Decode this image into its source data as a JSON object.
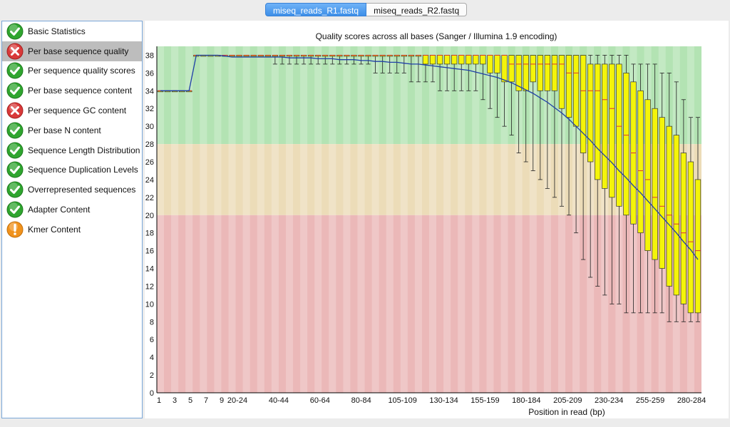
{
  "tabs": [
    {
      "label": "miseq_reads_R1.fastq",
      "active": true
    },
    {
      "label": "miseq_reads_R2.fastq",
      "active": false
    }
  ],
  "modules": [
    {
      "label": "Basic Statistics",
      "status": "pass",
      "icon": "check-icon"
    },
    {
      "label": "Per base sequence quality",
      "status": "fail",
      "icon": "cross-icon",
      "selected": true
    },
    {
      "label": "Per sequence quality scores",
      "status": "pass",
      "icon": "check-icon"
    },
    {
      "label": "Per base sequence content",
      "status": "pass",
      "icon": "check-icon"
    },
    {
      "label": "Per sequence GC content",
      "status": "fail",
      "icon": "cross-icon"
    },
    {
      "label": "Per base N content",
      "status": "pass",
      "icon": "check-icon"
    },
    {
      "label": "Sequence Length Distribution",
      "status": "pass",
      "icon": "check-icon"
    },
    {
      "label": "Sequence Duplication Levels",
      "status": "pass",
      "icon": "check-icon"
    },
    {
      "label": "Overrepresented sequences",
      "status": "pass",
      "icon": "check-icon"
    },
    {
      "label": "Adapter Content",
      "status": "pass",
      "icon": "check-icon"
    },
    {
      "label": "Kmer Content",
      "status": "warn",
      "icon": "warning-icon"
    }
  ],
  "colors": {
    "pass": "#2fa52f",
    "fail": "#d93a3a",
    "warn": "#f0921c",
    "zone_good": "#b3e3b3",
    "zone_ok": "#ecdcb8",
    "zone_bad": "#ebb8b8",
    "box_fill": "#f4f40a",
    "mean_line": "#1f3fa8",
    "median": "#d33"
  },
  "chart_data": {
    "type": "box",
    "title": "Quality scores across all bases (Sanger / Illumina 1.9 encoding)",
    "xlabel": "Position in read (bp)",
    "ylabel": "",
    "ylim": [
      0,
      39
    ],
    "yticks": [
      0,
      2,
      4,
      6,
      8,
      10,
      12,
      14,
      16,
      18,
      20,
      22,
      24,
      26,
      28,
      30,
      32,
      34,
      36,
      38
    ],
    "xtick_labels": [
      "1",
      "3",
      "5",
      "7",
      "9",
      "20-24",
      "40-44",
      "60-64",
      "80-84",
      "105-109",
      "130-134",
      "155-159",
      "180-184",
      "205-209",
      "230-234",
      "255-259",
      "280-284"
    ],
    "zones": [
      {
        "name": "good",
        "from": 28,
        "to": 39
      },
      {
        "name": "reasonable",
        "from": 20,
        "to": 28
      },
      {
        "name": "poor",
        "from": 0,
        "to": 20
      }
    ],
    "bins": [
      {
        "q1": 34,
        "med": 34,
        "q3": 34,
        "lw": 34,
        "uw": 34,
        "mean": 34
      },
      {
        "q1": 34,
        "med": 34,
        "q3": 34,
        "lw": 34,
        "uw": 34,
        "mean": 34
      },
      {
        "q1": 34,
        "med": 34,
        "q3": 34,
        "lw": 34,
        "uw": 34,
        "mean": 34
      },
      {
        "q1": 34,
        "med": 34,
        "q3": 34,
        "lw": 34,
        "uw": 34,
        "mean": 34
      },
      {
        "q1": 34,
        "med": 34,
        "q3": 34,
        "lw": 34,
        "uw": 34,
        "mean": 34
      },
      {
        "q1": 38,
        "med": 38,
        "q3": 38,
        "lw": 38,
        "uw": 38,
        "mean": 38
      },
      {
        "q1": 38,
        "med": 38,
        "q3": 38,
        "lw": 38,
        "uw": 38,
        "mean": 38
      },
      {
        "q1": 38,
        "med": 38,
        "q3": 38,
        "lw": 38,
        "uw": 38,
        "mean": 38
      },
      {
        "q1": 38,
        "med": 38,
        "q3": 38,
        "lw": 38,
        "uw": 38,
        "mean": 38
      },
      {
        "q1": 38,
        "med": 38,
        "q3": 38,
        "lw": 38,
        "uw": 38,
        "mean": 37.9
      },
      {
        "q1": 38,
        "med": 38,
        "q3": 38,
        "lw": 38,
        "uw": 38,
        "mean": 37.8
      },
      {
        "q1": 38,
        "med": 38,
        "q3": 38,
        "lw": 38,
        "uw": 38,
        "mean": 37.8
      },
      {
        "q1": 38,
        "med": 38,
        "q3": 38,
        "lw": 38,
        "uw": 38,
        "mean": 37.8
      },
      {
        "q1": 38,
        "med": 38,
        "q3": 38,
        "lw": 38,
        "uw": 38,
        "mean": 37.8
      },
      {
        "q1": 38,
        "med": 38,
        "q3": 38,
        "lw": 38,
        "uw": 38,
        "mean": 37.8
      },
      {
        "q1": 38,
        "med": 38,
        "q3": 38,
        "lw": 38,
        "uw": 38,
        "mean": 37.8
      },
      {
        "q1": 38,
        "med": 38,
        "q3": 38,
        "lw": 37,
        "uw": 38,
        "mean": 37.8
      },
      {
        "q1": 38,
        "med": 38,
        "q3": 38,
        "lw": 37,
        "uw": 38,
        "mean": 37.8
      },
      {
        "q1": 38,
        "med": 38,
        "q3": 38,
        "lw": 37,
        "uw": 38,
        "mean": 37.7
      },
      {
        "q1": 38,
        "med": 38,
        "q3": 38,
        "lw": 37,
        "uw": 38,
        "mean": 37.7
      },
      {
        "q1": 38,
        "med": 38,
        "q3": 38,
        "lw": 37,
        "uw": 38,
        "mean": 37.7
      },
      {
        "q1": 38,
        "med": 38,
        "q3": 38,
        "lw": 37,
        "uw": 38,
        "mean": 37.7
      },
      {
        "q1": 38,
        "med": 38,
        "q3": 38,
        "lw": 37,
        "uw": 38,
        "mean": 37.6
      },
      {
        "q1": 38,
        "med": 38,
        "q3": 38,
        "lw": 37,
        "uw": 38,
        "mean": 37.6
      },
      {
        "q1": 38,
        "med": 38,
        "q3": 38,
        "lw": 37,
        "uw": 38,
        "mean": 37.6
      },
      {
        "q1": 38,
        "med": 38,
        "q3": 38,
        "lw": 37,
        "uw": 38,
        "mean": 37.5
      },
      {
        "q1": 38,
        "med": 38,
        "q3": 38,
        "lw": 37,
        "uw": 38,
        "mean": 37.5
      },
      {
        "q1": 38,
        "med": 38,
        "q3": 38,
        "lw": 37,
        "uw": 38,
        "mean": 37.5
      },
      {
        "q1": 38,
        "med": 38,
        "q3": 38,
        "lw": 37,
        "uw": 38,
        "mean": 37.4
      },
      {
        "q1": 38,
        "med": 38,
        "q3": 38,
        "lw": 37,
        "uw": 38,
        "mean": 37.4
      },
      {
        "q1": 38,
        "med": 38,
        "q3": 38,
        "lw": 36,
        "uw": 38,
        "mean": 37.3
      },
      {
        "q1": 38,
        "med": 38,
        "q3": 38,
        "lw": 36,
        "uw": 38,
        "mean": 37.3
      },
      {
        "q1": 38,
        "med": 38,
        "q3": 38,
        "lw": 36,
        "uw": 38,
        "mean": 37.2
      },
      {
        "q1": 38,
        "med": 38,
        "q3": 38,
        "lw": 36,
        "uw": 38,
        "mean": 37.2
      },
      {
        "q1": 38,
        "med": 38,
        "q3": 38,
        "lw": 36,
        "uw": 38,
        "mean": 37.1
      },
      {
        "q1": 38,
        "med": 38,
        "q3": 38,
        "lw": 35,
        "uw": 38,
        "mean": 37.0
      },
      {
        "q1": 38,
        "med": 38,
        "q3": 38,
        "lw": 35,
        "uw": 38,
        "mean": 37.0
      },
      {
        "q1": 37,
        "med": 38,
        "q3": 38,
        "lw": 35,
        "uw": 38,
        "mean": 36.9
      },
      {
        "q1": 37,
        "med": 38,
        "q3": 38,
        "lw": 35,
        "uw": 38,
        "mean": 36.8
      },
      {
        "q1": 37,
        "med": 38,
        "q3": 38,
        "lw": 34,
        "uw": 38,
        "mean": 36.7
      },
      {
        "q1": 37,
        "med": 38,
        "q3": 38,
        "lw": 34,
        "uw": 38,
        "mean": 36.6
      },
      {
        "q1": 37,
        "med": 38,
        "q3": 38,
        "lw": 34,
        "uw": 38,
        "mean": 36.5
      },
      {
        "q1": 37,
        "med": 38,
        "q3": 38,
        "lw": 34,
        "uw": 38,
        "mean": 36.4
      },
      {
        "q1": 37,
        "med": 38,
        "q3": 38,
        "lw": 34,
        "uw": 38,
        "mean": 36.3
      },
      {
        "q1": 37,
        "med": 38,
        "q3": 38,
        "lw": 34,
        "uw": 38,
        "mean": 36.1
      },
      {
        "q1": 37,
        "med": 38,
        "q3": 38,
        "lw": 33,
        "uw": 38,
        "mean": 35.9
      },
      {
        "q1": 36,
        "med": 38,
        "q3": 38,
        "lw": 32,
        "uw": 38,
        "mean": 35.7
      },
      {
        "q1": 36,
        "med": 38,
        "q3": 38,
        "lw": 31,
        "uw": 38,
        "mean": 35.5
      },
      {
        "q1": 35,
        "med": 38,
        "q3": 38,
        "lw": 30,
        "uw": 38,
        "mean": 35.2
      },
      {
        "q1": 35,
        "med": 37,
        "q3": 38,
        "lw": 29,
        "uw": 38,
        "mean": 34.9
      },
      {
        "q1": 34,
        "med": 37,
        "q3": 38,
        "lw": 27,
        "uw": 38,
        "mean": 34.5
      },
      {
        "q1": 34,
        "med": 37,
        "q3": 38,
        "lw": 26,
        "uw": 38,
        "mean": 34.1
      },
      {
        "q1": 35,
        "med": 37,
        "q3": 38,
        "lw": 25,
        "uw": 38,
        "mean": 33.7
      },
      {
        "q1": 34,
        "med": 37,
        "q3": 38,
        "lw": 24,
        "uw": 38,
        "mean": 33.2
      },
      {
        "q1": 34,
        "med": 37,
        "q3": 38,
        "lw": 23,
        "uw": 38,
        "mean": 32.7
      },
      {
        "q1": 34,
        "med": 37,
        "q3": 38,
        "lw": 22,
        "uw": 38,
        "mean": 32.1
      },
      {
        "q1": 32,
        "med": 37,
        "q3": 38,
        "lw": 21,
        "uw": 38,
        "mean": 31.5
      },
      {
        "q1": 31,
        "med": 36,
        "q3": 38,
        "lw": 20,
        "uw": 38,
        "mean": 30.8
      },
      {
        "q1": 30,
        "med": 36,
        "q3": 38,
        "lw": 18,
        "uw": 38,
        "mean": 30.0
      },
      {
        "q1": 27,
        "med": 34,
        "q3": 38,
        "lw": 15,
        "uw": 38,
        "mean": 29.2
      },
      {
        "q1": 26,
        "med": 34,
        "q3": 37,
        "lw": 13,
        "uw": 38,
        "mean": 28.4
      },
      {
        "q1": 24,
        "med": 34,
        "q3": 37,
        "lw": 12,
        "uw": 38,
        "mean": 27.5
      },
      {
        "q1": 23,
        "med": 33,
        "q3": 37,
        "lw": 11,
        "uw": 38,
        "mean": 26.7
      },
      {
        "q1": 22,
        "med": 32,
        "q3": 37,
        "lw": 10,
        "uw": 38,
        "mean": 25.9
      },
      {
        "q1": 21,
        "med": 30,
        "q3": 37,
        "lw": 10,
        "uw": 38,
        "mean": 25.0
      },
      {
        "q1": 20,
        "med": 29,
        "q3": 36,
        "lw": 9,
        "uw": 38,
        "mean": 24.2
      },
      {
        "q1": 19,
        "med": 27,
        "q3": 35,
        "lw": 9,
        "uw": 37,
        "mean": 23.3
      },
      {
        "q1": 18,
        "med": 25,
        "q3": 34,
        "lw": 9,
        "uw": 37,
        "mean": 22.5
      },
      {
        "q1": 16,
        "med": 24,
        "q3": 33,
        "lw": 9,
        "uw": 37,
        "mean": 21.6
      },
      {
        "q1": 15,
        "med": 22,
        "q3": 32,
        "lw": 9,
        "uw": 37,
        "mean": 20.7
      },
      {
        "q1": 14,
        "med": 21,
        "q3": 31,
        "lw": 9,
        "uw": 36,
        "mean": 19.8
      },
      {
        "q1": 12,
        "med": 20,
        "q3": 30,
        "lw": 8,
        "uw": 36,
        "mean": 18.9
      },
      {
        "q1": 11,
        "med": 19,
        "q3": 29,
        "lw": 8,
        "uw": 35,
        "mean": 18.0
      },
      {
        "q1": 10,
        "med": 18,
        "q3": 27,
        "lw": 8,
        "uw": 33,
        "mean": 17.0
      },
      {
        "q1": 9,
        "med": 17,
        "q3": 26,
        "lw": 8,
        "uw": 31,
        "mean": 16.1
      },
      {
        "q1": 9,
        "med": 16,
        "q3": 24,
        "lw": 8,
        "uw": 31,
        "mean": 15.0
      }
    ]
  }
}
